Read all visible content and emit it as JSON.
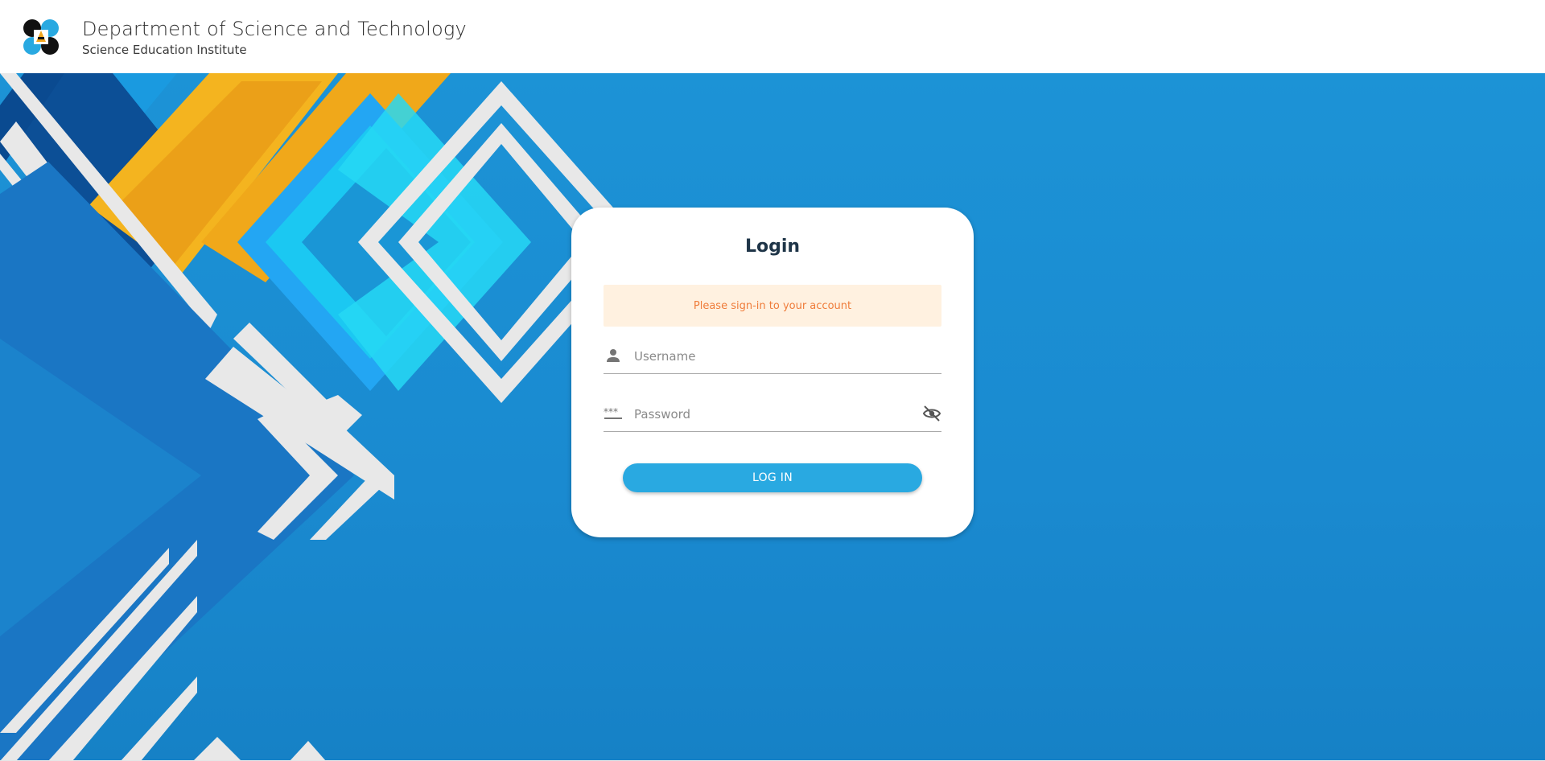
{
  "header": {
    "org_title": "Department of Science and Technology",
    "org_subtitle": "Science Education Institute",
    "logo_icon": "dost-logo-icon"
  },
  "login": {
    "title": "Login",
    "alert_message": "Please sign-in to your account",
    "username": {
      "placeholder": "Username",
      "value": "",
      "icon": "person-icon"
    },
    "password": {
      "placeholder": "Password",
      "value": "",
      "icon": "password-dots-icon",
      "toggle_icon": "eye-off-icon"
    },
    "submit_label": "LOG IN"
  },
  "colors": {
    "background_blue": "#1c93d6",
    "accent_button": "#29a9e1",
    "alert_bg": "#fff1e0",
    "alert_text": "#ef7c3a",
    "title_text": "#1f3548",
    "orange": "#f1a51d",
    "cyan": "#1fd0f0"
  }
}
